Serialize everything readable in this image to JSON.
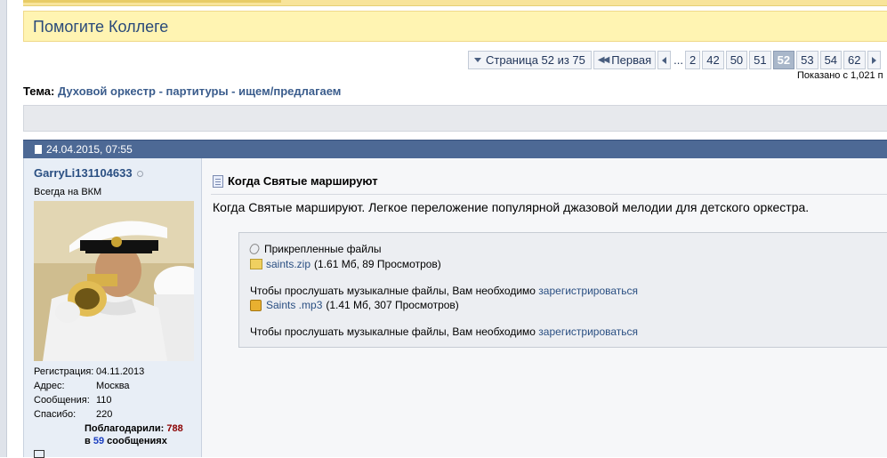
{
  "banner": {
    "title": "Помогите Коллеге"
  },
  "pagination": {
    "page_label": "Страница 52 из 75",
    "first_label": "Первая",
    "dots": "...",
    "pages": [
      "2",
      "42",
      "50",
      "51",
      "52",
      "53",
      "54",
      "62"
    ],
    "current": "52"
  },
  "shown_text": "Показано с 1,021 п",
  "topic": {
    "label": "Тема:",
    "name": "Духовой оркестр - партитуры - ищем/предлагаем"
  },
  "post": {
    "date": "24.04.2015, 07:55",
    "title": "Когда Святые маршируют",
    "text": "Когда Святые маршируют. Легкое переложение популярной джазовой мелодии для детского оркестра.",
    "attachments_title": "Прикрепленные файлы",
    "files": [
      {
        "name": "saints.zip",
        "info": "(1.61 Мб, 89 Просмотров)"
      },
      {
        "name": "Saints .mp3",
        "info": "(1.41 Мб, 307 Просмотров)"
      }
    ],
    "note_text": "Чтобы прослушать музыкалные файлы, Вам необходимо",
    "register_link": "зарегистрироваться"
  },
  "user": {
    "name": "GarryLi131104633",
    "title": "Всегда на ВКМ",
    "stats": [
      {
        "k": "Регистрация:",
        "v": "04.11.2013"
      },
      {
        "k": "Адрес:",
        "v": "Москва"
      },
      {
        "k": "Сообщения:",
        "v": "110"
      },
      {
        "k": "Спасибо:",
        "v": "220"
      }
    ],
    "thanks_label": "Поблагодарили:",
    "thanks_count": "788",
    "thanks_in": "в",
    "thanks_posts": "59",
    "thanks_suffix": "сообщениях"
  },
  "colors": {
    "header_blue": "#4d6995",
    "link_blue": "#2a4f82",
    "banner_yellow": "#fff4b2"
  }
}
